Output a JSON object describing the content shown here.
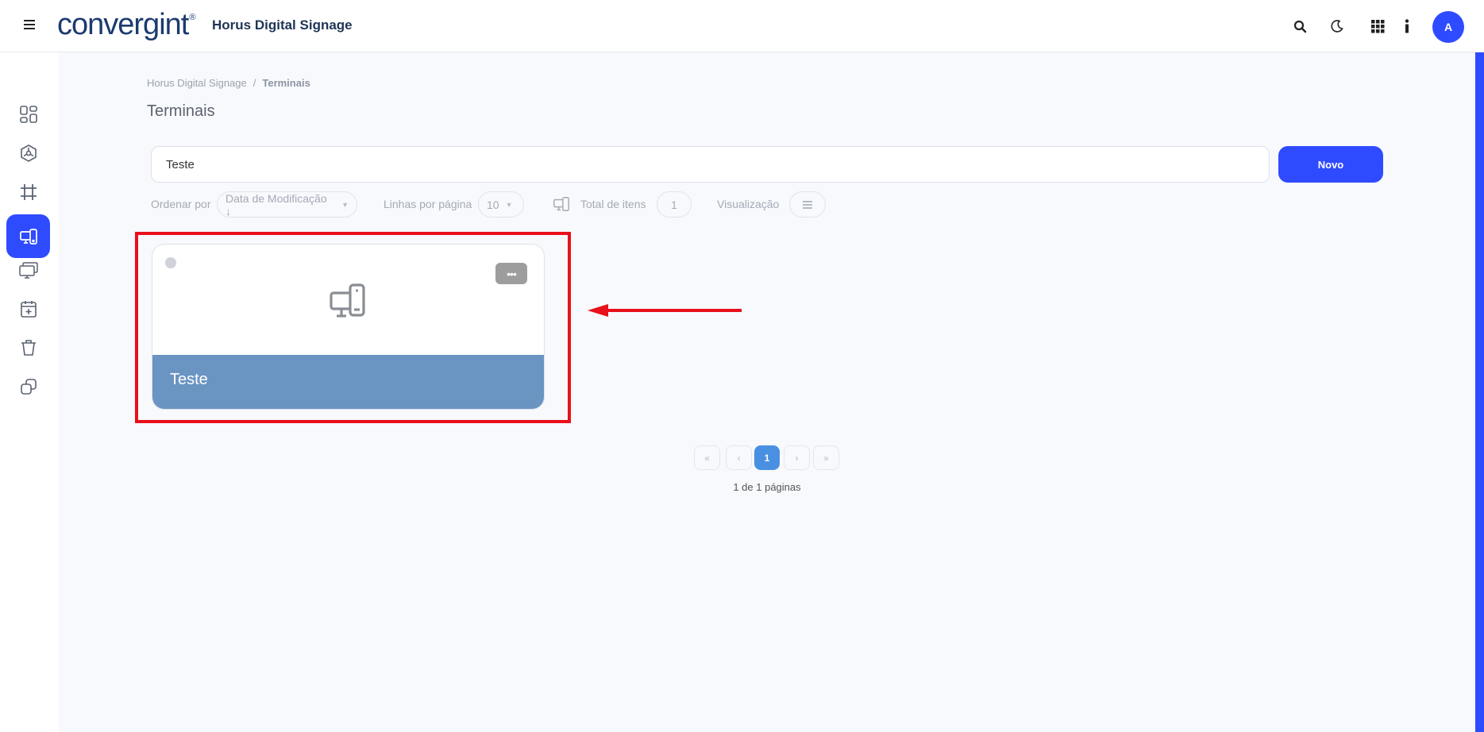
{
  "header": {
    "logo_text": "convergint",
    "logo_tm": "®",
    "app_title": "Horus Digital Signage",
    "avatar_initial": "A"
  },
  "breadcrumb": {
    "root": "Horus Digital Signage",
    "separator": "/",
    "current": "Terminais"
  },
  "page_title": "Terminais",
  "search": {
    "value": "Teste",
    "new_button_label": "Novo"
  },
  "filters": {
    "sort_label": "Ordenar por",
    "sort_value": "Data de Modificação ↓",
    "rows_label": "Linhas por página",
    "rows_value": "10",
    "total_label": "Total de itens",
    "total_value": "1",
    "view_label": "Visualização"
  },
  "card": {
    "name": "Teste",
    "more_label": "•••"
  },
  "pagination": {
    "first": "«",
    "prev": "‹",
    "current": "1",
    "next": "›",
    "last": "»",
    "info": "1 de 1 páginas"
  },
  "sidebar_icons": [
    "dashboard-icon",
    "cube-icon",
    "layout-grid-icon",
    "content-book-icon",
    "terminal-devices-icon",
    "displays-icon",
    "calendar-add-icon",
    "trash-icon",
    "layers-icon"
  ],
  "colors": {
    "accent": "#2f4bff",
    "card_footer": "#6a94c2",
    "highlight": "#e8101a",
    "pager_active": "#4a90e2"
  }
}
